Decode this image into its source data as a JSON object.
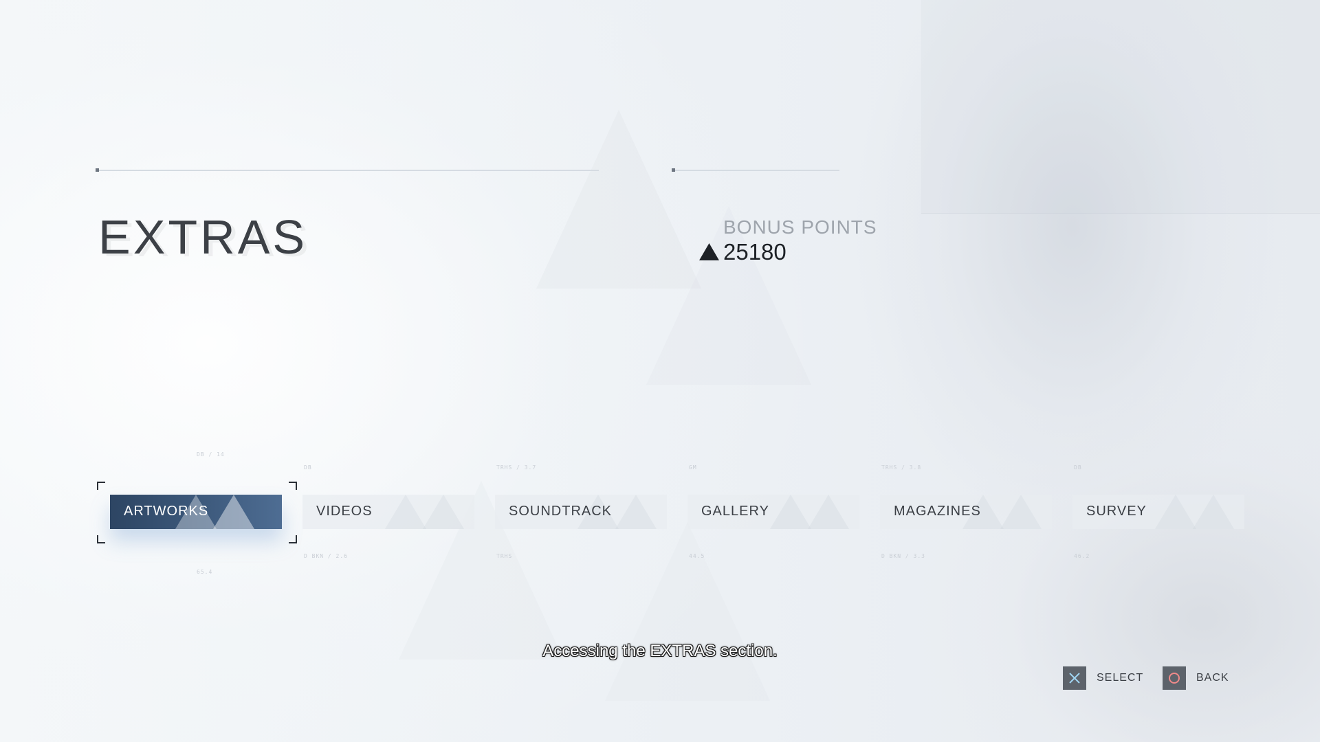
{
  "header": {
    "title": "EXTRAS",
    "bonus_label": "BONUS POINTS",
    "bonus_value": "25180",
    "bonus_icon": "triangle-icon"
  },
  "menu": {
    "selected_index": 0,
    "items": [
      {
        "label": "ARTWORKS",
        "tag_top": "DB / 14",
        "tag_bottom": "65.4"
      },
      {
        "label": "VIDEOS",
        "tag_top": "DB",
        "tag_bottom": "D BKN / 2.6"
      },
      {
        "label": "SOUNDTRACK",
        "tag_top": "TRHS / 3.7",
        "tag_bottom": "TRHS"
      },
      {
        "label": "GALLERY",
        "tag_top": "GM",
        "tag_bottom": "44.5"
      },
      {
        "label": "MAGAZINES",
        "tag_top": "TRHS / 3.8",
        "tag_bottom": "D BKN / 3.3"
      },
      {
        "label": "SURVEY",
        "tag_top": "DB",
        "tag_bottom": "46.2"
      }
    ]
  },
  "subtitle": "Accessing the EXTRAS section.",
  "prompts": {
    "select_label": "SELECT",
    "select_icon": "cross-button-icon",
    "back_label": "BACK",
    "back_icon": "circle-button-icon"
  },
  "colors": {
    "selected_bg": "#3f5c7f",
    "cross": "#9fd3f0",
    "circle": "#f08a8a",
    "text_dark": "#3b3f45"
  }
}
